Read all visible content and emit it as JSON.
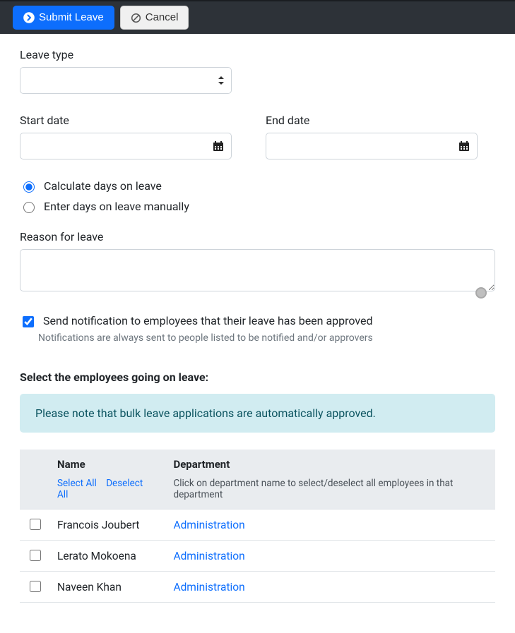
{
  "toolbar": {
    "submit_label": "Submit Leave",
    "cancel_label": "Cancel"
  },
  "form": {
    "leave_type_label": "Leave type",
    "start_date_label": "Start date",
    "end_date_label": "End date",
    "calc_option_auto": "Calculate days on leave",
    "calc_option_manual": "Enter days on leave manually",
    "reason_label": "Reason for leave",
    "notify_label": "Send notification to employees that their leave has been approved",
    "notify_help": "Notifications are always sent to people listed to be notified and/or approvers"
  },
  "employees_section": {
    "heading": "Select the employees going on leave:",
    "info": "Please note that bulk leave applications are automatically approved.",
    "col_name": "Name",
    "col_dept": "Department",
    "select_all": "Select All",
    "deselect_all": "Deselect All",
    "dept_hint": "Click on department name to select/deselect all employees in that department",
    "rows": [
      {
        "name": "Francois Joubert",
        "dept": "Administration"
      },
      {
        "name": "Lerato Mokoena",
        "dept": "Administration"
      },
      {
        "name": "Naveen Khan",
        "dept": "Administration"
      }
    ]
  }
}
